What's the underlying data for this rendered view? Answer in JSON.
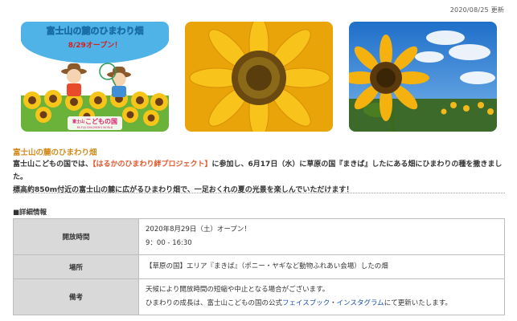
{
  "updated": "2020/08/25 更新",
  "poster": {
    "title": "富士山の麓のひまわり畑",
    "subtitle": "8/29オープン！",
    "logo_small": "富士山",
    "logo_main": "こどもの国",
    "logo_en": "Mt.FUJI CHILDREN'S WORLD"
  },
  "section_title": "富士山の麓のひまわり畑",
  "intro": {
    "part1": "富士山こどもの国では、",
    "highlight": "【はるかのひまわり絆プロジェクト】",
    "part2": "に参加し、6月17日（水）に草原の国『まきば』したにある畑にひまわりの種を撒きました。",
    "line2": "標高約850m付近の富士山の麓に広がるひまわり畑で、一足おくれの夏の光景を楽しんでいただけます！"
  },
  "details_heading": "■詳細情報",
  "details": {
    "hours_label": "開放時間",
    "hours_line1": "2020年8月29日（土）オープン！",
    "hours_line2": "9：00 - 16:30",
    "place_label": "場所",
    "place_value": "【草原の国】エリア『まきば』（ポニー・ヤギなど動物ふれあい会場）したの畑",
    "notes_label": "備考",
    "notes_line1": "天候により開放時間の短縮や中止となる場合がございます。",
    "notes_line2_pre": "ひまわりの成長は、富士山こどもの国の公式",
    "notes_link1": "フェイスブック",
    "notes_sep": "・",
    "notes_link2": "インスタグラム",
    "notes_line2_post": "にて更新いたします。"
  },
  "colors": {
    "accent_orange": "#d48a1a",
    "highlight_red": "#e2562b",
    "link_blue": "#1a4fb0",
    "table_header_bg": "#d9d9d9"
  }
}
